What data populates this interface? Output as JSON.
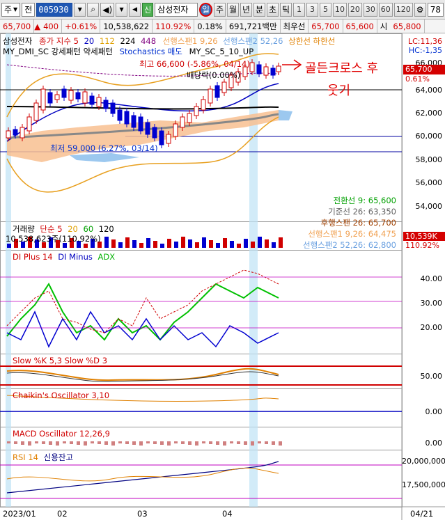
{
  "toolbar": {
    "market_select": "주",
    "period_select": "전",
    "code": "005930",
    "stock_name": "삼성전자",
    "sin_badge": "신",
    "periods": [
      "일",
      "주",
      "월",
      "년",
      "분",
      "초",
      "틱"
    ],
    "active_period": "일",
    "num_buttons": [
      "1",
      "3",
      "5",
      "10",
      "20",
      "30",
      "60",
      "120"
    ],
    "right_value": "78"
  },
  "quote": {
    "price": "65,700",
    "change": "400",
    "change_pct": "+0.61%",
    "volume": "10,538,622",
    "volume_ratio": "110.92%",
    "turnover_ratio": "0.18%",
    "amount": "691,721백만",
    "best_ask_label": "최우선",
    "best_ask": "65,700",
    "best_bid": "65,600",
    "open_label": "시",
    "open": "65,800"
  },
  "main_pane": {
    "legend_name": "삼성전자",
    "ma_label": "종가 지수 5",
    "ma_periods": [
      "20",
      "112",
      "224",
      "448"
    ],
    "ichimoku_span_legend": "선행스팬1 9,26",
    "ichimoku_span2_legend": "선행스팬2 52,26",
    "envelope_legend": "상한선 하한선",
    "dmi_legend": "MY_DMI_SC 강세패턴 약세패턴",
    "stoch_legend": "Stochastics 매도",
    "sc_legend": "MY_SC_5_10_UP",
    "lc_label": "LC:11,36",
    "hc_label": "HC:-1,35",
    "high_annotation": "최고 66,600 (-5.86%, 04/14)",
    "dividend_annotation": "배당락(0.00%)",
    "low_annotation": "최저 59,000 (6.27%, 03/14)",
    "price_axis": [
      "66,000",
      "64,000",
      "62,000",
      "60,000",
      "58,000",
      "56,000",
      "54,000"
    ],
    "current_price_tag": "65,700",
    "current_pct_tag": "0.61%",
    "ichimoku_values": [
      {
        "label": "전환선 9: 65,600",
        "color": "#00a000"
      },
      {
        "label": "기준선 26: 63,350",
        "color": "#606060"
      },
      {
        "label": "후행스팬 26: 65,700",
        "color": "#a04000"
      },
      {
        "label": "선행스팬1 9,26: 64,475",
        "color": "#f0a050"
      },
      {
        "label": "선행스팬2 52,26: 62,800",
        "color": "#6aa0e0"
      }
    ],
    "handwritten_note_1": "골든크로스 후",
    "handwritten_note_2": "웃기"
  },
  "volume_pane": {
    "legend": "거래량",
    "legend_periods": [
      "단순 5",
      "20",
      "60",
      "120"
    ],
    "value_text": "10,538,623주(110.92%)",
    "axis": "10,539K",
    "tag_volume": "10,539K",
    "tag_pct": "110.92%"
  },
  "dmi_pane": {
    "legend_plus": "DI Plus 14",
    "legend_minus": "DI Minus",
    "legend_adx": "ADX",
    "axis": [
      "40.00",
      "30.00",
      "20.00"
    ]
  },
  "stoch_pane": {
    "legend": "Slow %K 5,3  Slow %D 3",
    "axis": [
      "50.00"
    ]
  },
  "chaikin_pane": {
    "legend": "Chaikin's Oscillator 3,10",
    "axis": [
      "0.00"
    ]
  },
  "macd_pane": {
    "legend": "MACD Oscillator 12,26,9",
    "axis": [
      "0.00"
    ]
  },
  "rsi_pane": {
    "legend_rsi": "RSI 14",
    "legend_credit": "신용잔고",
    "axis": [
      "20,000,000",
      "17,500,000"
    ]
  },
  "date_axis": [
    "2023/01",
    "02",
    "03",
    "04",
    "04/21"
  ]
}
